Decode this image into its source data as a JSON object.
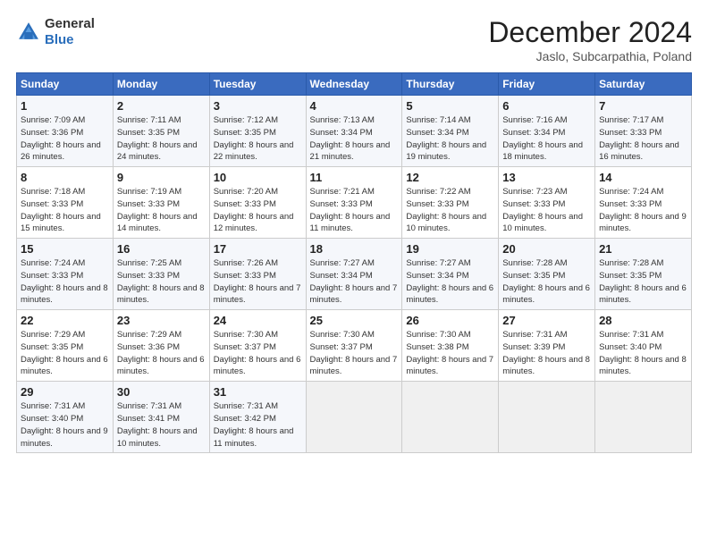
{
  "header": {
    "logo": {
      "general": "General",
      "blue": "Blue"
    },
    "title": "December 2024",
    "location": "Jaslo, Subcarpathia, Poland"
  },
  "days_of_week": [
    "Sunday",
    "Monday",
    "Tuesday",
    "Wednesday",
    "Thursday",
    "Friday",
    "Saturday"
  ],
  "weeks": [
    [
      {
        "day": "1",
        "sunrise": "7:09 AM",
        "sunset": "3:36 PM",
        "daylight": "8 hours and 26 minutes."
      },
      {
        "day": "2",
        "sunrise": "7:11 AM",
        "sunset": "3:35 PM",
        "daylight": "8 hours and 24 minutes."
      },
      {
        "day": "3",
        "sunrise": "7:12 AM",
        "sunset": "3:35 PM",
        "daylight": "8 hours and 22 minutes."
      },
      {
        "day": "4",
        "sunrise": "7:13 AM",
        "sunset": "3:34 PM",
        "daylight": "8 hours and 21 minutes."
      },
      {
        "day": "5",
        "sunrise": "7:14 AM",
        "sunset": "3:34 PM",
        "daylight": "8 hours and 19 minutes."
      },
      {
        "day": "6",
        "sunrise": "7:16 AM",
        "sunset": "3:34 PM",
        "daylight": "8 hours and 18 minutes."
      },
      {
        "day": "7",
        "sunrise": "7:17 AM",
        "sunset": "3:33 PM",
        "daylight": "8 hours and 16 minutes."
      }
    ],
    [
      {
        "day": "8",
        "sunrise": "7:18 AM",
        "sunset": "3:33 PM",
        "daylight": "8 hours and 15 minutes."
      },
      {
        "day": "9",
        "sunrise": "7:19 AM",
        "sunset": "3:33 PM",
        "daylight": "8 hours and 14 minutes."
      },
      {
        "day": "10",
        "sunrise": "7:20 AM",
        "sunset": "3:33 PM",
        "daylight": "8 hours and 12 minutes."
      },
      {
        "day": "11",
        "sunrise": "7:21 AM",
        "sunset": "3:33 PM",
        "daylight": "8 hours and 11 minutes."
      },
      {
        "day": "12",
        "sunrise": "7:22 AM",
        "sunset": "3:33 PM",
        "daylight": "8 hours and 10 minutes."
      },
      {
        "day": "13",
        "sunrise": "7:23 AM",
        "sunset": "3:33 PM",
        "daylight": "8 hours and 10 minutes."
      },
      {
        "day": "14",
        "sunrise": "7:24 AM",
        "sunset": "3:33 PM",
        "daylight": "8 hours and 9 minutes."
      }
    ],
    [
      {
        "day": "15",
        "sunrise": "7:24 AM",
        "sunset": "3:33 PM",
        "daylight": "8 hours and 8 minutes."
      },
      {
        "day": "16",
        "sunrise": "7:25 AM",
        "sunset": "3:33 PM",
        "daylight": "8 hours and 8 minutes."
      },
      {
        "day": "17",
        "sunrise": "7:26 AM",
        "sunset": "3:33 PM",
        "daylight": "8 hours and 7 minutes."
      },
      {
        "day": "18",
        "sunrise": "7:27 AM",
        "sunset": "3:34 PM",
        "daylight": "8 hours and 7 minutes."
      },
      {
        "day": "19",
        "sunrise": "7:27 AM",
        "sunset": "3:34 PM",
        "daylight": "8 hours and 6 minutes."
      },
      {
        "day": "20",
        "sunrise": "7:28 AM",
        "sunset": "3:35 PM",
        "daylight": "8 hours and 6 minutes."
      },
      {
        "day": "21",
        "sunrise": "7:28 AM",
        "sunset": "3:35 PM",
        "daylight": "8 hours and 6 minutes."
      }
    ],
    [
      {
        "day": "22",
        "sunrise": "7:29 AM",
        "sunset": "3:35 PM",
        "daylight": "8 hours and 6 minutes."
      },
      {
        "day": "23",
        "sunrise": "7:29 AM",
        "sunset": "3:36 PM",
        "daylight": "8 hours and 6 minutes."
      },
      {
        "day": "24",
        "sunrise": "7:30 AM",
        "sunset": "3:37 PM",
        "daylight": "8 hours and 6 minutes."
      },
      {
        "day": "25",
        "sunrise": "7:30 AM",
        "sunset": "3:37 PM",
        "daylight": "8 hours and 7 minutes."
      },
      {
        "day": "26",
        "sunrise": "7:30 AM",
        "sunset": "3:38 PM",
        "daylight": "8 hours and 7 minutes."
      },
      {
        "day": "27",
        "sunrise": "7:31 AM",
        "sunset": "3:39 PM",
        "daylight": "8 hours and 8 minutes."
      },
      {
        "day": "28",
        "sunrise": "7:31 AM",
        "sunset": "3:40 PM",
        "daylight": "8 hours and 8 minutes."
      }
    ],
    [
      {
        "day": "29",
        "sunrise": "7:31 AM",
        "sunset": "3:40 PM",
        "daylight": "8 hours and 9 minutes."
      },
      {
        "day": "30",
        "sunrise": "7:31 AM",
        "sunset": "3:41 PM",
        "daylight": "8 hours and 10 minutes."
      },
      {
        "day": "31",
        "sunrise": "7:31 AM",
        "sunset": "3:42 PM",
        "daylight": "8 hours and 11 minutes."
      },
      null,
      null,
      null,
      null
    ]
  ],
  "labels": {
    "sunrise": "Sunrise:",
    "sunset": "Sunset:",
    "daylight": "Daylight:"
  }
}
